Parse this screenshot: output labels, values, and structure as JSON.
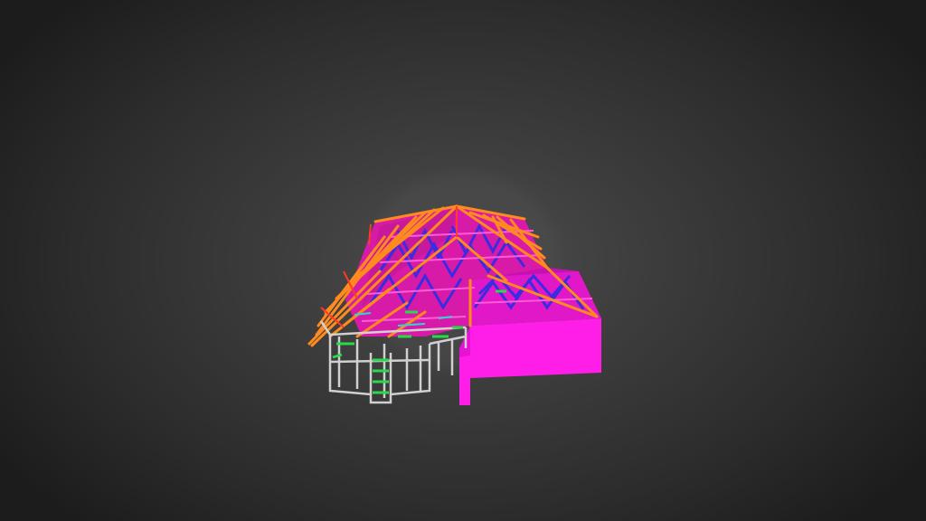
{
  "viewer": {
    "colors": {
      "background_center": "#4d4d4d",
      "background_edge": "#1c1c1c",
      "roof_panel": "#ff2cf0",
      "rafter": "#ff8a1e",
      "brace": "#3d2bd6",
      "truss": "#d62b9a",
      "wall_frame": "#c8c8c8",
      "stud": "#2ad64a",
      "ridge": "#ff4a2a"
    },
    "model": {
      "icon": "3d-model-icon"
    }
  }
}
